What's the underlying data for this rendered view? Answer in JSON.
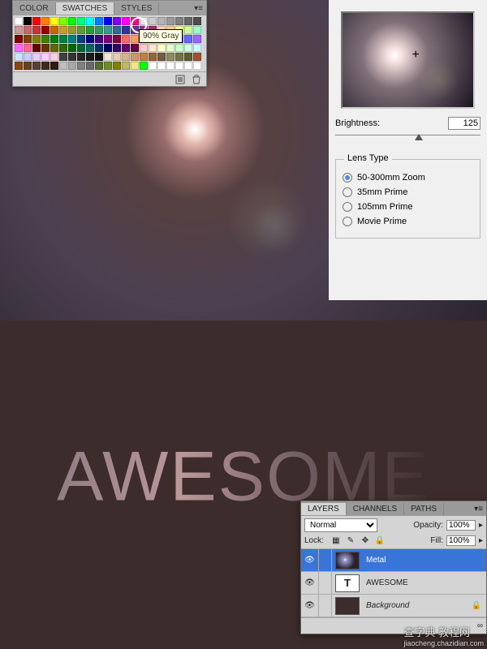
{
  "swatches": {
    "tabs": [
      "COLOR",
      "SWATCHES",
      "STYLES"
    ],
    "active_tab": 1,
    "tooltip": "90% Gray",
    "colors": [
      "#ffffff",
      "#000000",
      "#ff0000",
      "#ff8000",
      "#ffff00",
      "#80ff00",
      "#00ff00",
      "#00ff80",
      "#00ffff",
      "#0080ff",
      "#0000ff",
      "#8000ff",
      "#ff00ff",
      "#ff0080",
      "#e6e6e6",
      "#cccccc",
      "#b3b3b3",
      "#999999",
      "#808080",
      "#666666",
      "#4d4d4d",
      "#cc9999",
      "#cc6666",
      "#cc3333",
      "#990000",
      "#cc6600",
      "#cc9933",
      "#999933",
      "#669933",
      "#339933",
      "#339966",
      "#339999",
      "#336699",
      "#333399",
      "#663399",
      "#993399",
      "#993366",
      "#ffcccc",
      "#ffcc99",
      "#ffff99",
      "#ccff99",
      "#99ffcc",
      "#800000",
      "#804000",
      "#808000",
      "#408000",
      "#008000",
      "#008040",
      "#008080",
      "#004080",
      "#000080",
      "#400080",
      "#800080",
      "#800040",
      "#ff6666",
      "#ff9966",
      "#ffff66",
      "#99ff66",
      "#66ff99",
      "#66ffff",
      "#6699ff",
      "#6666ff",
      "#9966ff",
      "#ff66ff",
      "#ff6699",
      "#660000",
      "#663300",
      "#666600",
      "#336600",
      "#006600",
      "#006633",
      "#006666",
      "#003366",
      "#000066",
      "#330066",
      "#660066",
      "#660033",
      "#ffcccc",
      "#ffe6cc",
      "#ffffcc",
      "#e6ffcc",
      "#ccffcc",
      "#ccffe6",
      "#ccffff",
      "#cce6ff",
      "#ccccff",
      "#e6ccff",
      "#ffccff",
      "#ffcce6",
      "#404040",
      "#333333",
      "#262626",
      "#1a1a1a",
      "#0d0d0d",
      "#f2e6d9",
      "#e6ccb3",
      "#d9b38c",
      "#cc9966",
      "#bf8040",
      "#996633",
      "#735c45",
      "#8c8c5c",
      "#737345",
      "#5c5c2e",
      "#a0522d",
      "#8b4513",
      "#654321",
      "#5c4033",
      "#3d2b1f",
      "#2f1b0c",
      "#c0c0c0",
      "#a9a9a9",
      "#808080",
      "#696969",
      "#556b2f",
      "#6b8e23",
      "#808000",
      "#bdb76b",
      "#f0e68c",
      "#00ff00",
      "#ffffff",
      "#ffffff",
      "#ffffff",
      "#ffffff",
      "#ffffff",
      "#ffffff"
    ]
  },
  "lensflare": {
    "brightness_label": "Brightness:",
    "brightness_value": "125",
    "lens_type_label": "Lens Type",
    "options": [
      {
        "label": "50-300mm Zoom",
        "checked": true
      },
      {
        "label": "35mm Prime",
        "checked": false
      },
      {
        "label": "105mm Prime",
        "checked": false
      },
      {
        "label": "Movie Prime",
        "checked": false
      }
    ]
  },
  "artwork": {
    "text": "AWESOME"
  },
  "layers": {
    "tabs": [
      "LAYERS",
      "CHANNELS",
      "PATHS"
    ],
    "active_tab": 0,
    "blend_mode": "Normal",
    "opacity_label": "Opacity:",
    "opacity_value": "100%",
    "lock_label": "Lock:",
    "fill_label": "Fill:",
    "fill_value": "100%",
    "items": [
      {
        "name": "Metal",
        "selected": true,
        "type": "image",
        "locked": false
      },
      {
        "name": "AWESOME",
        "selected": false,
        "type": "text",
        "locked": false
      },
      {
        "name": "Background",
        "selected": false,
        "type": "bg",
        "locked": true
      }
    ]
  },
  "watermark": {
    "main": "查字典 教程网",
    "sub": "jiaocheng.chazidian.com"
  }
}
